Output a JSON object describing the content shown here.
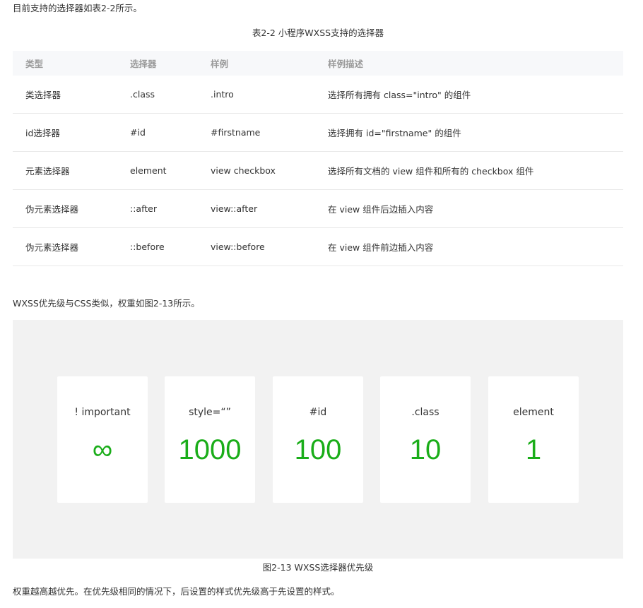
{
  "intro_text": "目前支持的选择器如表2-2所示。",
  "table": {
    "caption": "表2-2 小程序WXSS支持的选择器",
    "headers": [
      "类型",
      "选择器",
      "样例",
      "样例描述"
    ],
    "rows": [
      [
        "类选择器",
        ".class",
        ".intro",
        "选择所有拥有 class=\"intro\" 的组件"
      ],
      [
        "id选择器",
        "#id",
        "#firstname",
        "选择拥有 id=\"firstname\" 的组件"
      ],
      [
        "元素选择器",
        "element",
        "view checkbox",
        "选择所有文档的 view 组件和所有的 checkbox 组件"
      ],
      [
        "伪元素选择器",
        "::after",
        "view::after",
        "在 view 组件后边插入内容"
      ],
      [
        "伪元素选择器",
        "::before",
        "view::before",
        "在 view 组件前边插入内容"
      ]
    ]
  },
  "priority_text": "WXSS优先级与CSS类似，权重如图2-13所示。",
  "figure": {
    "caption": "图2-13 WXSS选择器优先级",
    "value_color": "#1aad19",
    "cards": [
      {
        "label": "! important",
        "value": "∞"
      },
      {
        "label": "style=“”",
        "value": "1000"
      },
      {
        "label": "#id",
        "value": "100"
      },
      {
        "label": ".class",
        "value": "10"
      },
      {
        "label": "element",
        "value": "1"
      }
    ]
  },
  "closing_text": "权重越高越优先。在优先级相同的情况下，后设置的样式优先级高于先设置的样式。"
}
